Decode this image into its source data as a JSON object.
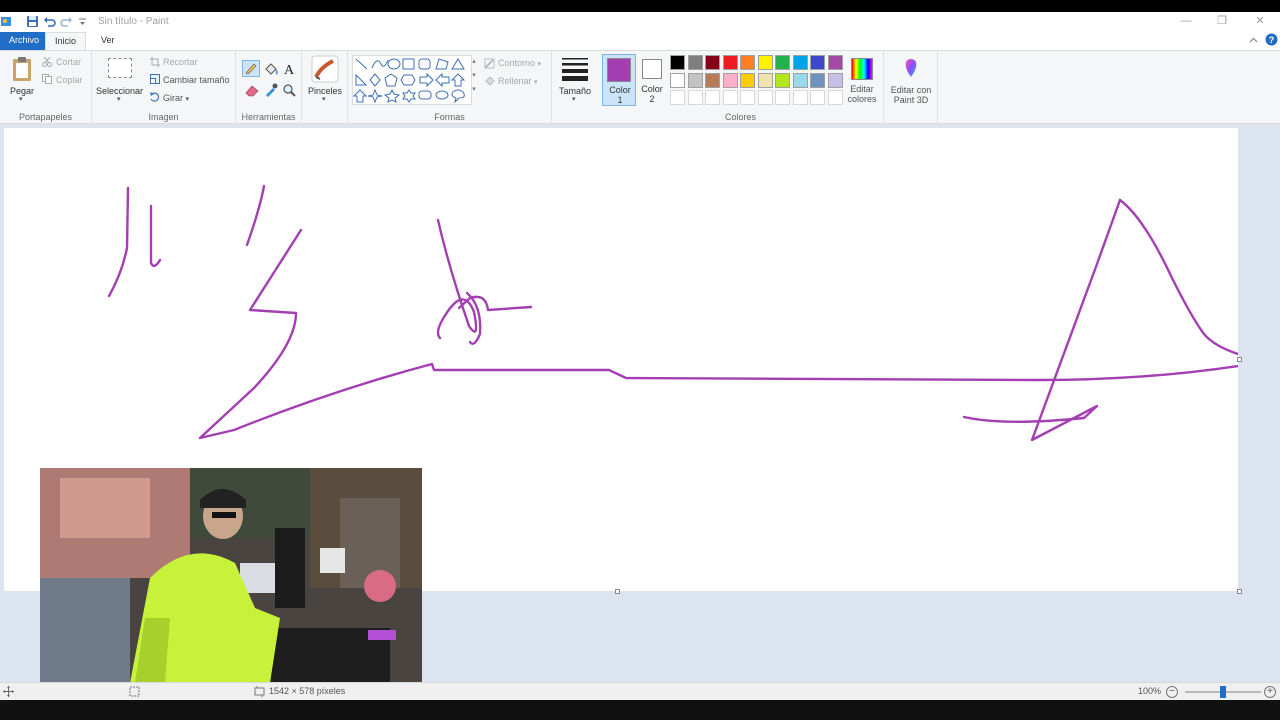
{
  "window": {
    "title": "Sin título - Paint",
    "controls": [
      "minimize",
      "restore",
      "close"
    ]
  },
  "tabs": [
    {
      "label": "Archivo",
      "active": false
    },
    {
      "label": "Inicio",
      "active": true
    },
    {
      "label": "Ver",
      "active": false
    }
  ],
  "ribbon": {
    "portapapeles": {
      "label": "Portapapeles",
      "paste": "Pegar",
      "cut": "Cortar",
      "copy": "Copiar"
    },
    "imagen": {
      "label": "Imagen",
      "select": "Seleccionar",
      "crop": "Recortar",
      "resize": "Cambiar tamaño",
      "rotate": "Girar"
    },
    "herramientas": {
      "label": "Herramientas"
    },
    "pinceles": {
      "label": "Pinceles"
    },
    "formas": {
      "label": "Formas",
      "outline": "Contorno",
      "fill": "Rellenar"
    },
    "tamano": {
      "label": "Tamaño"
    },
    "colores": {
      "label": "Colores",
      "color1": "Color 1",
      "color2": "Color 2",
      "color1_value": "#a33fb2",
      "color2_value": "#ffffff",
      "edit_colors": "Editar colores",
      "palette_row1": [
        "#000000",
        "#7f7f7f",
        "#880015",
        "#ed1c24",
        "#ff7f27",
        "#fff200",
        "#22b14c",
        "#00a2e8",
        "#3f48cc",
        "#a349a4"
      ],
      "palette_row2": [
        "#ffffff",
        "#c3c3c3",
        "#b97a57",
        "#ffaec9",
        "#ffc90e",
        "#efe4b0",
        "#b5e61d",
        "#99d9ea",
        "#7092be",
        "#c8bfe7"
      ]
    },
    "paint3d": {
      "label": "Editar con Paint 3D"
    }
  },
  "drawing": {
    "stroke_color": "#a33fb2"
  },
  "status": {
    "dimensions": "1542 × 578 píxeles",
    "zoom": "100%",
    "zoom_level_percent": 100
  }
}
